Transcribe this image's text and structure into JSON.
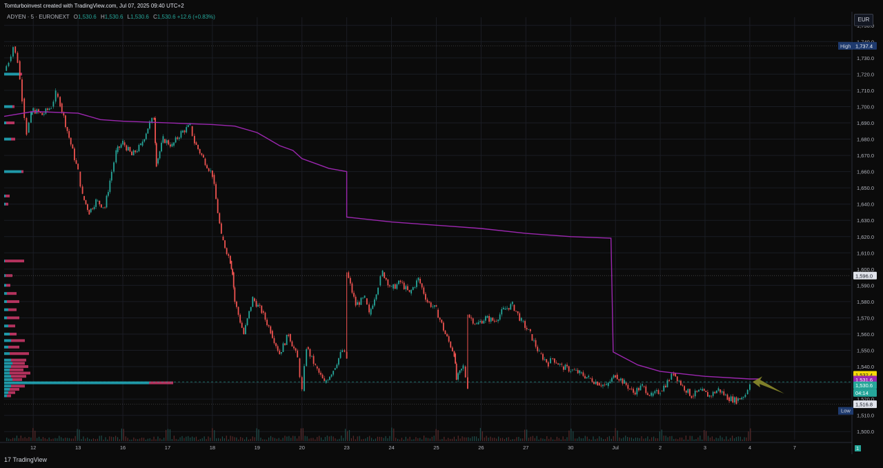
{
  "header": {
    "attribution": "Tomturboinvest created with TradingView.com, Jul 07, 2025 09:40 UTC+2"
  },
  "symbol_line": {
    "symbol": "ADYEN · 5 · EURONEXT",
    "o_label": "O",
    "o_value": "1,530.6",
    "h_label": "H",
    "h_value": "1,530.6",
    "l_label": "L",
    "l_value": "1,530.6",
    "c_label": "C",
    "c_value": "1,530.6",
    "change": "+12.6 (+0.83%)"
  },
  "currency": "EUR",
  "footer": {
    "logo_mark": "17",
    "logo_text": "TradingView"
  },
  "colors": {
    "background": "#0b0b0b",
    "bull": "#26a69a",
    "bear": "#ef5350",
    "vwap": "#9c27b0",
    "volume_profile_up": "#26c6da",
    "volume_profile_down": "#ec407a",
    "arrow": "#8b8b2b"
  },
  "chart_data": {
    "type": "line",
    "title": "",
    "xlabel": "",
    "ylabel": "",
    "ylim": [
      1495,
      1755
    ],
    "y_ticks": [
      "1,500.0",
      "1,510.0",
      "1,520.0",
      "1,530.0",
      "1,540.0",
      "1,550.0",
      "1,560.0",
      "1,570.0",
      "1,580.0",
      "1,590.0",
      "1,600.0",
      "1,610.0",
      "1,620.0",
      "1,630.0",
      "1,640.0",
      "1,650.0",
      "1,660.0",
      "1,670.0",
      "1,680.0",
      "1,690.0",
      "1,700.0",
      "1,710.0",
      "1,720.0",
      "1,730.0",
      "1,740.0",
      "1,750.0"
    ],
    "y_tick_values": [
      1500,
      1510,
      1520,
      1530,
      1540,
      1550,
      1560,
      1570,
      1580,
      1590,
      1600,
      1610,
      1620,
      1630,
      1640,
      1650,
      1660,
      1670,
      1680,
      1690,
      1700,
      1710,
      1720,
      1730,
      1740,
      1750
    ],
    "x_ticks": [
      {
        "label": "12",
        "t": 1
      },
      {
        "label": "13",
        "t": 2
      },
      {
        "label": "16",
        "t": 3
      },
      {
        "label": "17",
        "t": 4
      },
      {
        "label": "18",
        "t": 5
      },
      {
        "label": "19",
        "t": 6
      },
      {
        "label": "20",
        "t": 7
      },
      {
        "label": "23",
        "t": 8
      },
      {
        "label": "24",
        "t": 9
      },
      {
        "label": "25",
        "t": 10
      },
      {
        "label": "26",
        "t": 11
      },
      {
        "label": "27",
        "t": 12
      },
      {
        "label": "30",
        "t": 13
      },
      {
        "label": "Jul",
        "t": 14
      },
      {
        "label": "2",
        "t": 15
      },
      {
        "label": "3",
        "t": 16
      },
      {
        "label": "4",
        "t": 17
      },
      {
        "label": "7",
        "t": 18
      }
    ],
    "x_domain": [
      0.35,
      19.25
    ],
    "series": [
      {
        "type": "price",
        "points": [
          [
            0.35,
            1722
          ],
          [
            0.45,
            1728
          ],
          [
            0.55,
            1737
          ],
          [
            0.65,
            1728
          ],
          [
            0.75,
            1705
          ],
          [
            0.85,
            1684
          ],
          [
            0.95,
            1695
          ],
          [
            1.0,
            1698
          ],
          [
            1.2,
            1695
          ],
          [
            1.4,
            1700
          ],
          [
            1.5,
            1708
          ],
          [
            1.6,
            1702
          ],
          [
            2.0,
            1660
          ],
          [
            2.1,
            1645
          ],
          [
            2.25,
            1635
          ],
          [
            2.4,
            1642
          ],
          [
            2.6,
            1638
          ],
          [
            2.75,
            1660
          ],
          [
            2.85,
            1672
          ],
          [
            3.0,
            1678
          ],
          [
            3.2,
            1670
          ],
          [
            3.4,
            1676
          ],
          [
            3.6,
            1690
          ],
          [
            3.7,
            1693
          ],
          [
            3.75,
            1665
          ],
          [
            3.9,
            1680
          ],
          [
            4.1,
            1676
          ],
          [
            4.3,
            1684
          ],
          [
            4.5,
            1688
          ],
          [
            4.6,
            1678
          ],
          [
            4.8,
            1668
          ],
          [
            5.0,
            1658
          ],
          [
            5.2,
            1620
          ],
          [
            5.4,
            1605
          ],
          [
            5.45,
            1598
          ],
          [
            5.5,
            1580
          ],
          [
            5.7,
            1560
          ],
          [
            5.9,
            1582
          ],
          [
            6.1,
            1574
          ],
          [
            6.3,
            1562
          ],
          [
            6.5,
            1548
          ],
          [
            6.7,
            1560
          ],
          [
            6.9,
            1545
          ],
          [
            7.0,
            1525
          ],
          [
            7.1,
            1552
          ],
          [
            7.3,
            1540
          ],
          [
            7.5,
            1530
          ],
          [
            7.7,
            1538
          ],
          [
            7.9,
            1550
          ],
          [
            8.0,
            1545
          ],
          [
            8.0,
            1598
          ],
          [
            8.2,
            1578
          ],
          [
            8.4,
            1582
          ],
          [
            8.5,
            1572
          ],
          [
            8.7,
            1590
          ],
          [
            8.8,
            1598
          ],
          [
            9.0,
            1588
          ],
          [
            9.2,
            1592
          ],
          [
            9.4,
            1585
          ],
          [
            9.6,
            1594
          ],
          [
            9.8,
            1580
          ],
          [
            10.0,
            1575
          ],
          [
            10.2,
            1560
          ],
          [
            10.4,
            1548
          ],
          [
            10.45,
            1532
          ],
          [
            10.6,
            1540
          ],
          [
            10.7,
            1528
          ],
          [
            10.7,
            1572
          ],
          [
            10.9,
            1566
          ],
          [
            11.1,
            1570
          ],
          [
            11.3,
            1568
          ],
          [
            11.5,
            1575
          ],
          [
            11.7,
            1578
          ],
          [
            11.9,
            1568
          ],
          [
            12.1,
            1560
          ],
          [
            12.3,
            1548
          ],
          [
            12.5,
            1542
          ],
          [
            12.6,
            1545
          ],
          [
            12.8,
            1540
          ],
          [
            13.0,
            1538
          ],
          [
            13.2,
            1536
          ],
          [
            13.4,
            1533
          ],
          [
            13.6,
            1530
          ],
          [
            13.8,
            1528
          ],
          [
            14.0,
            1535
          ],
          [
            14.2,
            1530
          ],
          [
            14.4,
            1524
          ],
          [
            14.6,
            1528
          ],
          [
            14.8,
            1522
          ],
          [
            15.0,
            1525
          ],
          [
            15.2,
            1532
          ],
          [
            15.3,
            1536
          ],
          [
            15.5,
            1528
          ],
          [
            15.7,
            1522
          ],
          [
            15.9,
            1525
          ],
          [
            16.1,
            1522
          ],
          [
            16.3,
            1526
          ],
          [
            16.5,
            1521
          ],
          [
            16.7,
            1519
          ],
          [
            16.9,
            1523
          ],
          [
            17.0,
            1530.6
          ]
        ]
      },
      {
        "type": "vwap",
        "points": [
          [
            0.35,
            1694
          ],
          [
            1.0,
            1697
          ],
          [
            2.0,
            1696
          ],
          [
            2.5,
            1692
          ],
          [
            3.0,
            1691
          ],
          [
            5.0,
            1689
          ],
          [
            5.5,
            1688
          ],
          [
            6.0,
            1684
          ],
          [
            6.5,
            1676
          ],
          [
            6.8,
            1673
          ],
          [
            7.0,
            1668
          ],
          [
            7.3,
            1665
          ],
          [
            7.6,
            1662
          ],
          [
            8.0,
            1660
          ],
          [
            8.0,
            1632
          ],
          [
            9.0,
            1629
          ],
          [
            10.0,
            1627
          ],
          [
            11.0,
            1625
          ],
          [
            12.0,
            1622
          ],
          [
            13.0,
            1620
          ],
          [
            13.9,
            1619
          ],
          [
            13.95,
            1549
          ],
          [
            14.5,
            1541
          ],
          [
            15.0,
            1537
          ],
          [
            16.0,
            1534
          ],
          [
            17.0,
            1532.4
          ],
          [
            17.2,
            1532.4
          ]
        ]
      }
    ],
    "reference_lines": [
      {
        "name": "High",
        "value": 1737.4,
        "label": "1,737.4"
      },
      {
        "name": "Low",
        "value": 1516.8,
        "label": "1,516.8"
      },
      {
        "name": "level",
        "value": 1596.0,
        "label": "1,596.0"
      }
    ],
    "price_labels": [
      {
        "value": 1532.4,
        "label": "1,532.4",
        "kind": "vwap-yellow"
      },
      {
        "value": 1531.6,
        "label": "1,531.6",
        "kind": "vwap-purple"
      },
      {
        "value": 1530.6,
        "label": "1,530.6",
        "kind": "last"
      },
      {
        "text": "04:14",
        "kind": "countdown"
      }
    ],
    "volume_label": "1",
    "volume_profile": {
      "rows": [
        {
          "price": 1522,
          "up": 4,
          "down": 6
        },
        {
          "price": 1524,
          "up": 6,
          "down": 10
        },
        {
          "price": 1526,
          "up": 8,
          "down": 14
        },
        {
          "price": 1528,
          "up": 10,
          "down": 20
        },
        {
          "price": 1530,
          "up": 210,
          "down": 35
        },
        {
          "price": 1532,
          "up": 12,
          "down": 14
        },
        {
          "price": 1534,
          "up": 10,
          "down": 22
        },
        {
          "price": 1536,
          "up": 8,
          "down": 30
        },
        {
          "price": 1538,
          "up": 8,
          "down": 20
        },
        {
          "price": 1540,
          "up": 10,
          "down": 25
        },
        {
          "price": 1542,
          "up": 12,
          "down": 18
        },
        {
          "price": 1544,
          "up": 10,
          "down": 22
        },
        {
          "price": 1548,
          "up": 8,
          "down": 28
        },
        {
          "price": 1552,
          "up": 6,
          "down": 16
        },
        {
          "price": 1556,
          "up": 10,
          "down": 20
        },
        {
          "price": 1560,
          "up": 8,
          "down": 10
        },
        {
          "price": 1565,
          "up": 6,
          "down": 10
        },
        {
          "price": 1570,
          "up": 4,
          "down": 18
        },
        {
          "price": 1575,
          "up": 6,
          "down": 12
        },
        {
          "price": 1580,
          "up": 4,
          "down": 18
        },
        {
          "price": 1585,
          "up": 4,
          "down": 14
        },
        {
          "price": 1590,
          "up": 3,
          "down": 6
        },
        {
          "price": 1596,
          "up": 2,
          "down": 10
        },
        {
          "price": 1605,
          "up": 1,
          "down": 28
        },
        {
          "price": 1640,
          "up": 2,
          "down": 4
        },
        {
          "price": 1645,
          "up": 2,
          "down": 6
        },
        {
          "price": 1660,
          "up": 25,
          "down": 3
        },
        {
          "price": 1680,
          "up": 10,
          "down": 6
        },
        {
          "price": 1690,
          "up": 3,
          "down": 12
        },
        {
          "price": 1700,
          "up": 12,
          "down": 3
        },
        {
          "price": 1720,
          "up": 22,
          "down": 4
        }
      ]
    },
    "grid": true,
    "annotations": [
      {
        "type": "arrow",
        "at_x": 17.0,
        "at_y": 1530.6
      }
    ]
  }
}
